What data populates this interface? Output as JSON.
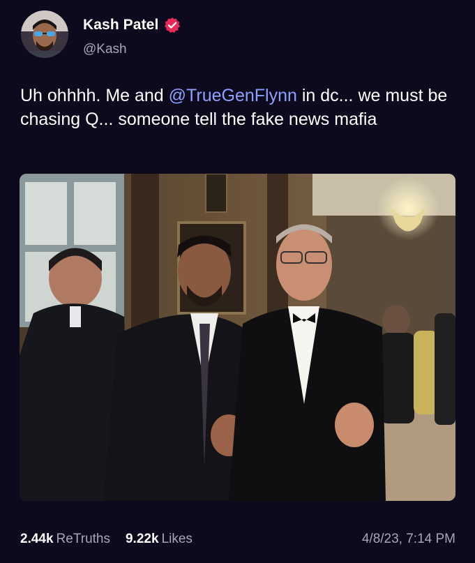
{
  "author": {
    "name": "Kash Patel",
    "handle": "@Kash",
    "verified": true
  },
  "post": {
    "text_before": "Uh ohhhh. Me and ",
    "mention": "@TrueGenFlynn",
    "text_after": " in dc... we must be chasing Q... someone tell the fake news mafia"
  },
  "stats": {
    "retruths_count": "2.44k",
    "retruths_label": "ReTruths",
    "likes_count": "9.22k",
    "likes_label": "Likes"
  },
  "timestamp": "4/8/23, 7:14 PM",
  "colors": {
    "background": "#0d0a1e",
    "mention": "#8ba0ff",
    "verified": "#e8295a",
    "muted_text": "#a8a5b4"
  }
}
